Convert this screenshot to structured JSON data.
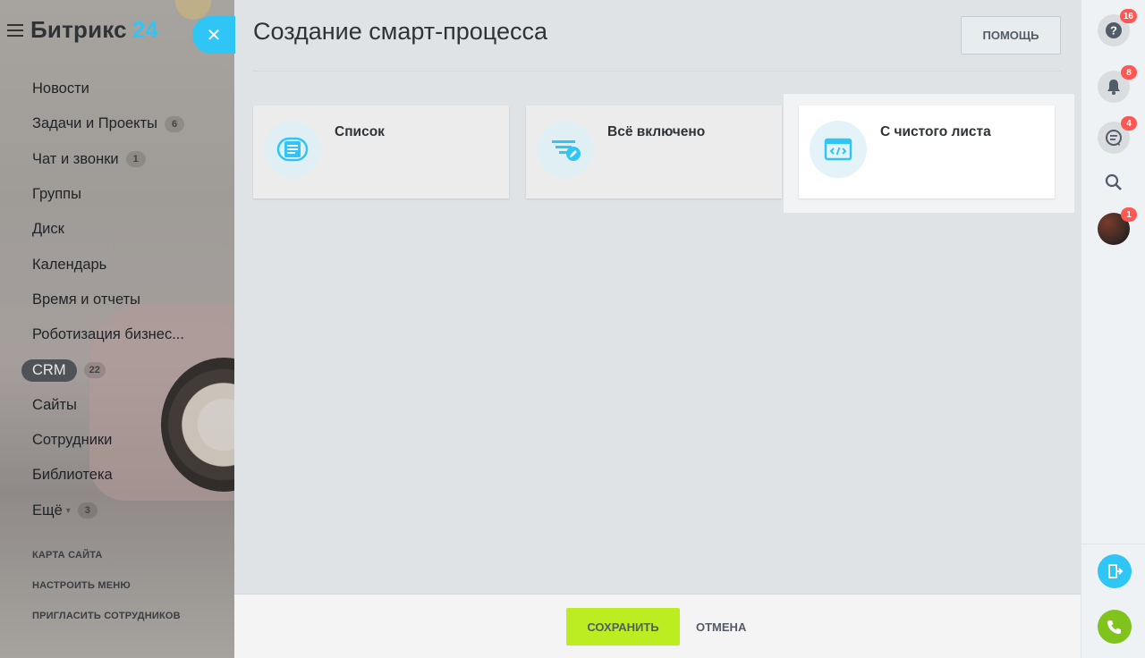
{
  "brand": {
    "name": "Битрикс",
    "number": "24"
  },
  "left_menu": {
    "items": [
      {
        "label": "Новости"
      },
      {
        "label": "Задачи и Проекты",
        "counter": "6"
      },
      {
        "label": "Чат и звонки",
        "counter": "1"
      },
      {
        "label": "Группы"
      },
      {
        "label": "Диск"
      },
      {
        "label": "Календарь"
      },
      {
        "label": "Время и отчеты"
      },
      {
        "label": "Роботизация бизнес..."
      },
      {
        "label": "CRM",
        "counter": "22"
      },
      {
        "label": "Сайты"
      },
      {
        "label": "Сотрудники"
      },
      {
        "label": "Библиотека"
      },
      {
        "label": "Ещё",
        "counter": "3"
      }
    ],
    "links": [
      "КАРТА САЙТА",
      "НАСТРОИТЬ МЕНЮ",
      "ПРИГЛАСИТЬ СОТРУДНИКОВ"
    ]
  },
  "panel": {
    "title": "Создание смарт-процесса",
    "help_label": "ПОМОЩЬ",
    "tiles": [
      {
        "label": "Список",
        "icon": "list-icon"
      },
      {
        "label": "Всё включено",
        "icon": "filter-edit-icon"
      },
      {
        "label": "С чистого листа",
        "icon": "code-window-icon",
        "selected": true
      }
    ],
    "footer": {
      "save_label": "СОХРАНИТЬ",
      "cancel_label": "ОТМЕНА"
    }
  },
  "right_bar": {
    "help_count": "16",
    "notifications_count": "8",
    "chat_count": "4",
    "avatar_count": "1"
  },
  "colors": {
    "accent": "#2fc6f6",
    "save": "#bbed21",
    "badge": "#ff5752",
    "phone": "#7fc31c"
  }
}
